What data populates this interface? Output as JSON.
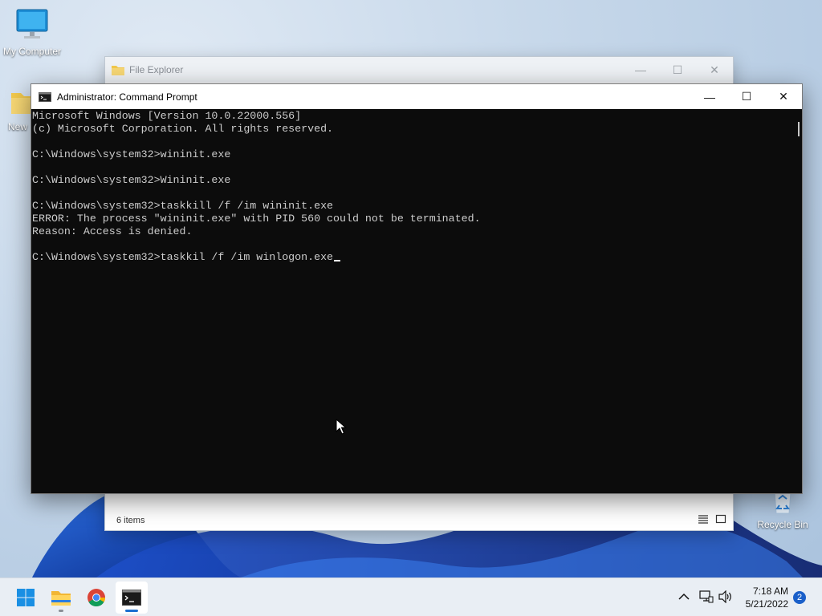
{
  "desktop": {
    "icons": [
      {
        "label": "My Computer"
      },
      {
        "label": "New"
      },
      {
        "label": "Recycle Bin"
      }
    ]
  },
  "file_explorer": {
    "title": "File Explorer",
    "status_items": "6 items",
    "controls": {
      "minimize": "—",
      "maximize": "☐",
      "close": "✕"
    }
  },
  "cmd": {
    "title": "Administrator: Command Prompt",
    "controls": {
      "minimize": "—",
      "maximize": "☐",
      "close": "✕"
    },
    "lines": [
      "Microsoft Windows [Version 10.0.22000.556]",
      "(c) Microsoft Corporation. All rights reserved.",
      "",
      "C:\\Windows\\system32>wininit.exe",
      "",
      "C:\\Windows\\system32>Wininit.exe",
      "",
      "C:\\Windows\\system32>taskkill /f /im wininit.exe",
      "ERROR: The process \"wininit.exe\" with PID 560 could not be terminated.",
      "Reason: Access is denied.",
      "",
      "C:\\Windows\\system32>taskkil /f /im winlogon.exe"
    ],
    "colors": {
      "background": "#0c0c0c",
      "text": "#cccccc"
    }
  },
  "taskbar": {
    "apps": [
      {
        "name": "start-button"
      },
      {
        "name": "file-explorer"
      },
      {
        "name": "chrome"
      },
      {
        "name": "command-prompt"
      }
    ],
    "clock": {
      "time": "7:18 AM",
      "date": "5/21/2022"
    },
    "notification_count": "2",
    "accent": "#1a6fd1"
  }
}
